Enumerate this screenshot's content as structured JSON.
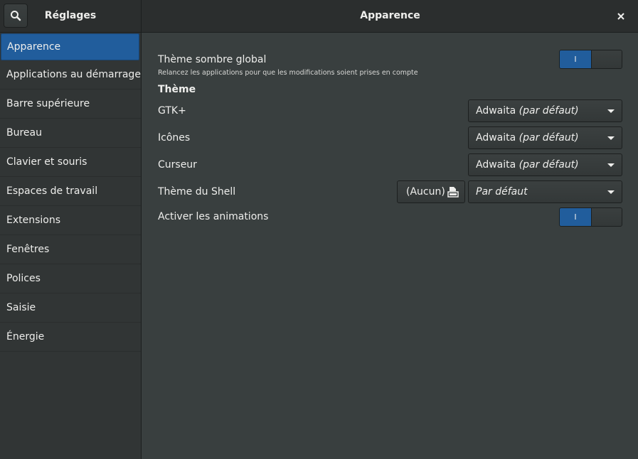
{
  "header": {
    "app_title": "Réglages",
    "page_title": "Apparence",
    "search_icon": "search-icon",
    "close_icon": "close-icon"
  },
  "sidebar": {
    "items": [
      {
        "label": "Apparence",
        "selected": true
      },
      {
        "label": "Applications au démarrage"
      },
      {
        "label": "Barre supérieure"
      },
      {
        "label": "Bureau"
      },
      {
        "label": "Clavier et souris"
      },
      {
        "label": "Espaces de travail"
      },
      {
        "label": "Extensions"
      },
      {
        "label": "Fenêtres"
      },
      {
        "label": "Polices"
      },
      {
        "label": "Saisie"
      },
      {
        "label": "Énergie"
      }
    ]
  },
  "main": {
    "dark_theme": {
      "label": "Thème sombre global",
      "subtitle": "Relancez les applications pour que les modifications soient prises en compte",
      "switch_on_label": "I",
      "enabled": true
    },
    "theme_section_title": "Thème",
    "gtk": {
      "label": "GTK+",
      "value": "Adwaita",
      "value_suffix": "(par défaut)"
    },
    "icons": {
      "label": "Icônes",
      "value": "Adwaita",
      "value_suffix": "(par défaut)"
    },
    "cursor": {
      "label": "Curseur",
      "value": "Adwaita",
      "value_suffix": "(par défaut)"
    },
    "shell": {
      "label": "Thème du Shell",
      "file_button_label": "(Aucun)",
      "file_icon": "document-open-icon",
      "value": "Par défaut"
    },
    "animations": {
      "label": "Activer les animations",
      "switch_on_label": "I",
      "enabled": true
    }
  },
  "colors": {
    "accent": "#215d9c",
    "background": "#393f3f",
    "sidebar": "#313535",
    "headerbar": "#2b2e2e"
  }
}
